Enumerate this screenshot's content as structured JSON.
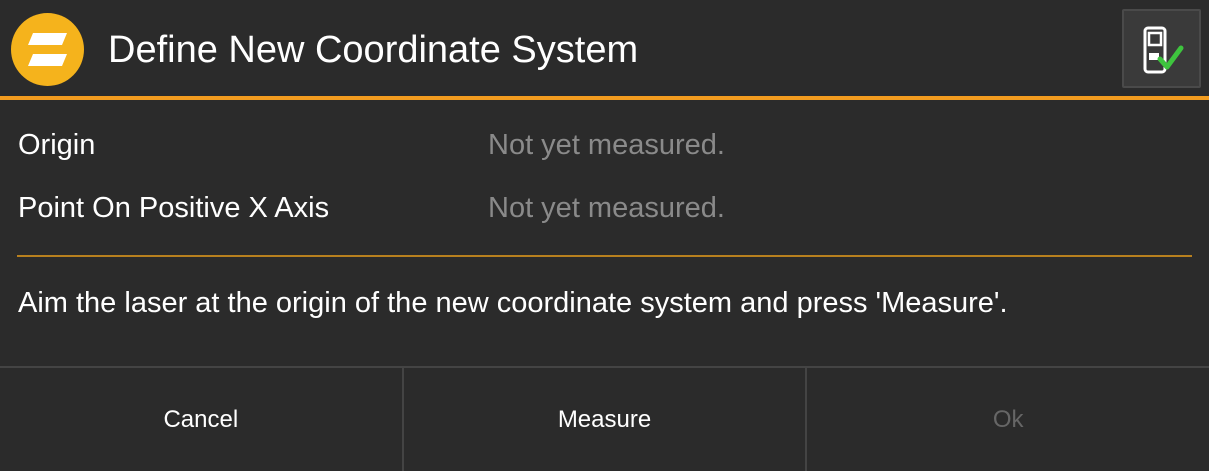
{
  "header": {
    "title": "Define New Coordinate System",
    "app_icon": "app-logo-icon",
    "device_icon": "device-connected-check-icon"
  },
  "rows": [
    {
      "label": "Origin",
      "value": "Not yet measured."
    },
    {
      "label": "Point On Positive X Axis",
      "value": "Not yet measured."
    }
  ],
  "instruction": "Aim the laser at the origin of the new coordinate system and press 'Measure'.",
  "buttons": {
    "cancel": "Cancel",
    "measure": "Measure",
    "ok": "Ok"
  },
  "colors": {
    "accent": "#f29c1f",
    "logo": "#f5b31c",
    "check": "#3ec43e",
    "background": "#2b2b2b"
  }
}
